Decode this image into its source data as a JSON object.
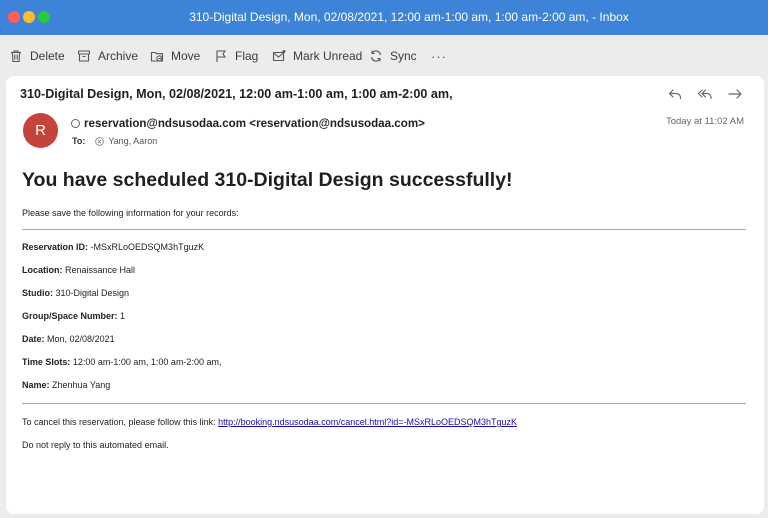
{
  "window": {
    "title": "310-Digital Design, Mon, 02/08/2021, 12:00 am-1:00 am, 1:00 am-2:00 am,  - Inbox"
  },
  "toolbar": {
    "delete_label": "Delete",
    "archive_label": "Archive",
    "move_label": "Move",
    "flag_label": "Flag",
    "mark_unread_label": "Mark Unread",
    "sync_label": "Sync",
    "more_label": "···"
  },
  "message": {
    "subject": "310-Digital Design, Mon, 02/08/2021, 12:00 am-1:00 am, 1:00 am-2:00 am,",
    "avatar_initial": "R",
    "from": "reservation@ndsusodaa.com <reservation@ndsusodaa.com>",
    "to_label": "To:",
    "to_recipient": "Yang, Aaron",
    "date": "Today at 11:02 AM"
  },
  "content": {
    "headline": "You have scheduled 310-Digital Design successfully!",
    "intro": "Please save the following information for your records:",
    "fields": [
      {
        "label": "Reservation ID:",
        "value": "-MSxRLoOEDSQM3hTguzK"
      },
      {
        "label": "Location:",
        "value": "Renaissance Hall"
      },
      {
        "label": "Studio:",
        "value": "310-Digital Design"
      },
      {
        "label": "Group/Space Number:",
        "value": "1"
      },
      {
        "label": "Date:",
        "value": "Mon, 02/08/2021"
      },
      {
        "label": "Time Slots:",
        "value": "12:00 am-1:00 am, 1:00 am-2:00 am,"
      },
      {
        "label": "Name:",
        "value": "Zhenhua Yang"
      }
    ],
    "cancel_text": "To cancel this reservation, please follow this link:",
    "cancel_link": "http://booking.ndsusodaa.com/cancel.html?id=-MSxRLoOEDSQM3hTguzK",
    "no_reply": "Do not reply to this automated email."
  },
  "icons": {
    "delete": "trash-icon",
    "archive": "archive-box-icon",
    "move": "folder-move-icon",
    "flag": "flag-icon",
    "mark_unread": "envelope-icon",
    "sync": "sync-arrows-icon",
    "reply": "reply-icon",
    "reply_all": "reply-all-icon",
    "forward": "forward-icon"
  },
  "colors": {
    "titlebar": "#3d84d8",
    "avatar": "#c4433a",
    "link": "#1a0dab"
  }
}
